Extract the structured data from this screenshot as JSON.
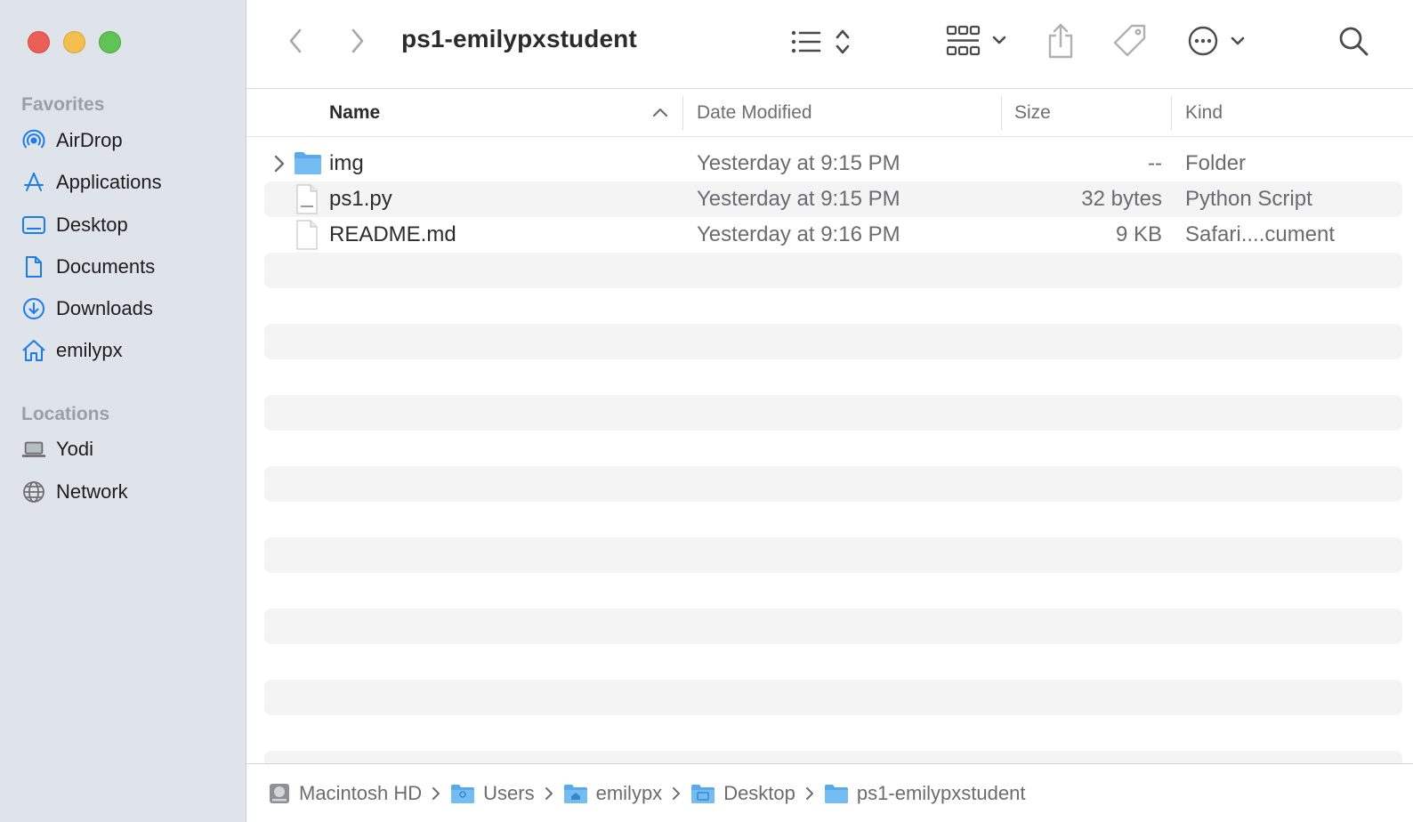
{
  "window": {
    "title": "ps1-emilypxstudent"
  },
  "sidebar": {
    "favorites_title": "Favorites",
    "favorites": [
      {
        "label": "AirDrop",
        "icon": "airdrop-icon"
      },
      {
        "label": "Applications",
        "icon": "applications-icon"
      },
      {
        "label": "Desktop",
        "icon": "desktop-icon"
      },
      {
        "label": "Documents",
        "icon": "documents-icon"
      },
      {
        "label": "Downloads",
        "icon": "downloads-icon"
      },
      {
        "label": "emilypx",
        "icon": "home-icon"
      }
    ],
    "locations_title": "Locations",
    "locations": [
      {
        "label": "Yodi",
        "icon": "laptop-icon"
      },
      {
        "label": "Network",
        "icon": "network-icon"
      }
    ]
  },
  "columns": {
    "name": "Name",
    "date": "Date Modified",
    "size": "Size",
    "kind": "Kind"
  },
  "files": [
    {
      "name": "img",
      "date": "Yesterday at 9:15 PM",
      "size": "--",
      "kind": "Folder",
      "icon": "folder-icon"
    },
    {
      "name": "ps1.py",
      "date": "Yesterday at 9:15 PM",
      "size": "32 bytes",
      "kind": "Python Script",
      "icon": "python-file-icon"
    },
    {
      "name": "README.md",
      "date": "Yesterday at 9:16 PM",
      "size": "9 KB",
      "kind": "Safari....cument",
      "icon": "document-file-icon"
    }
  ],
  "pathbar": [
    {
      "label": "Macintosh HD",
      "icon": "hard-drive-icon"
    },
    {
      "label": "Users",
      "icon": "users-folder-icon"
    },
    {
      "label": "emilypx",
      "icon": "home-folder-icon"
    },
    {
      "label": "Desktop",
      "icon": "desktop-folder-icon"
    },
    {
      "label": "ps1-emilypxstudent",
      "icon": "folder-icon"
    }
  ],
  "colors": {
    "accent": "#1a7cf0",
    "sidebar_bg": "#dfe3ea",
    "close": "#ec5f57",
    "minimize": "#f5bf4f",
    "maximize": "#5fc454"
  }
}
